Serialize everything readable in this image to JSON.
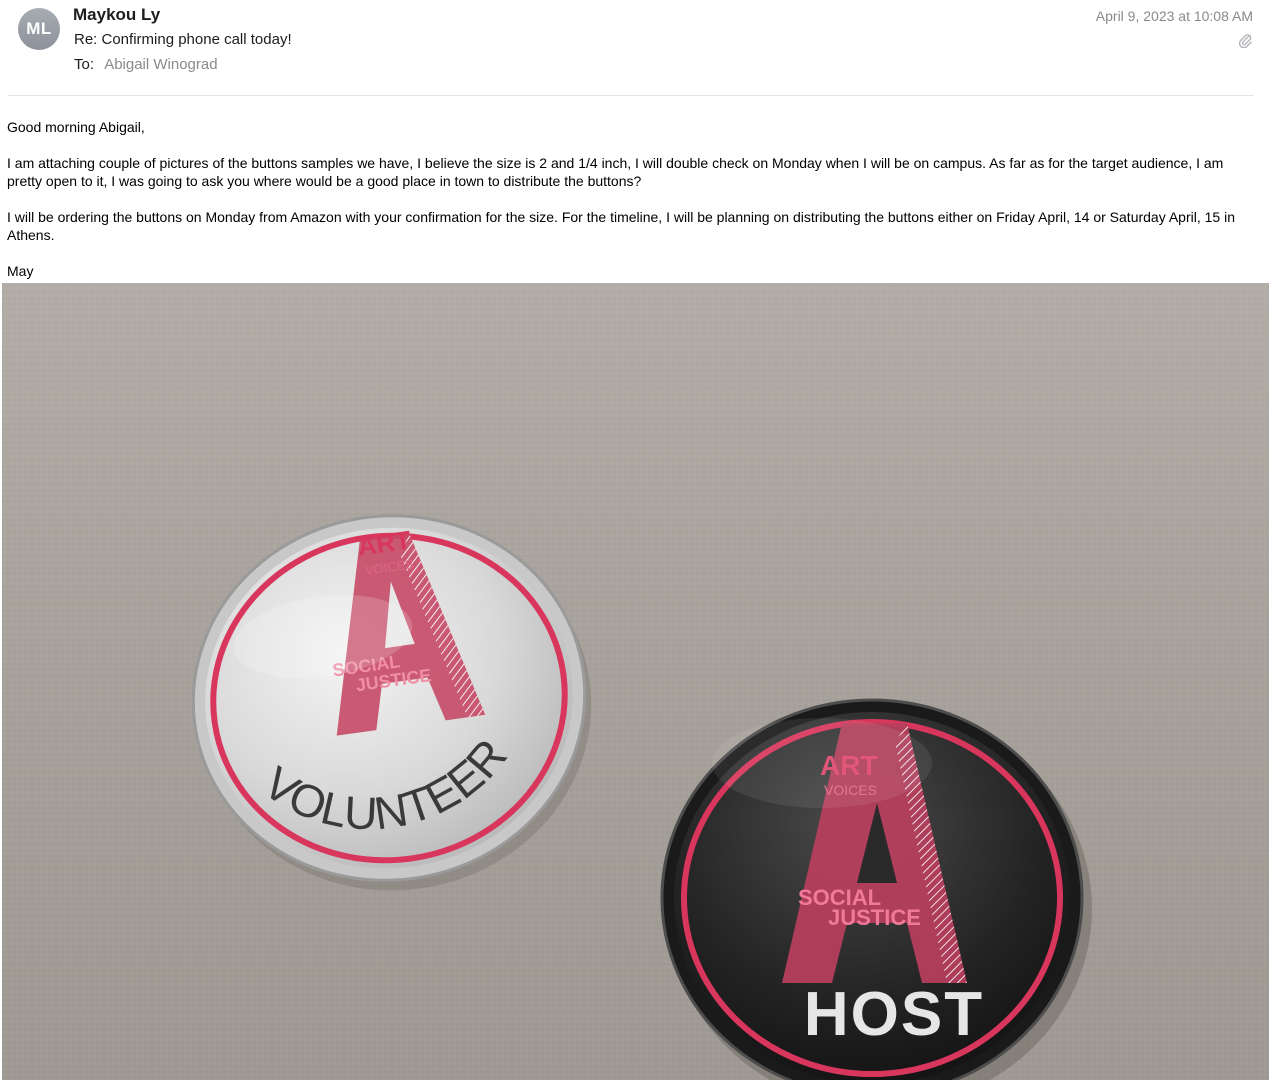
{
  "email": {
    "avatar_initials": "ML",
    "sender": "Maykou Ly",
    "subject": "Re: Confirming phone call today!",
    "to_label": "To:",
    "to_value": "Abigail Winograd",
    "date": "April 9, 2023 at 10:08 AM",
    "attachment_icon": "paperclip-icon"
  },
  "body": {
    "greeting": "Good morning Abigail,",
    "paragraph1": "I am attaching couple of pictures of the buttons samples we have, I believe the size is 2 and 1/4 inch, I will double check on Monday when I will be on campus. As far as for the target audience, I am pretty open to it, I was going to ask you where would be a good place in town to distribute the buttons?",
    "paragraph2": "I will be ordering the buttons on Monday from Amazon with your confirmation for the size. For the timeline, I will be planning on distributing the buttons either on Friday April, 14 or Saturday April, 15 in Athens.",
    "signoff": "May"
  },
  "photo": {
    "button1": {
      "word_top": "ART",
      "word_mid": "VOICES",
      "word_low1": "SOCIAL",
      "word_low2": "JUSTICE",
      "label": "VOLUNTEER"
    },
    "button2": {
      "word_top": "ART",
      "word_mid": "VOICES",
      "word_low1": "SOCIAL",
      "word_low2": "JUSTICE",
      "label": "HOST"
    }
  },
  "colors": {
    "accent_pink": "#d8365c",
    "background_fabric": "#a9a49d",
    "muted_text": "#8a8a8e"
  }
}
